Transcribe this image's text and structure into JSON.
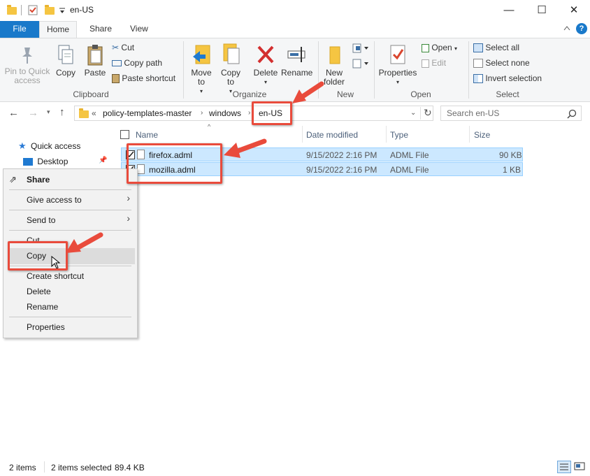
{
  "window": {
    "title": "en-US",
    "minimize": "—",
    "maximize": "☐",
    "close": "✕"
  },
  "tabs": {
    "file": "File",
    "home": "Home",
    "share": "Share",
    "view": "View"
  },
  "ribbon": {
    "pin": "Pin to Quick access",
    "copy": "Copy",
    "paste": "Paste",
    "cut": "Cut",
    "copy_path": "Copy path",
    "paste_shortcut": "Paste shortcut",
    "clipboard_group": "Clipboard",
    "move_to": "Move to",
    "copy_to": "Copy to",
    "delete": "Delete",
    "rename": "Rename",
    "organize_group": "Organize",
    "new_folder": "New folder",
    "new_group": "New",
    "properties": "Properties",
    "open": "Open",
    "edit": "Edit",
    "open_group": "Open",
    "select_all": "Select all",
    "select_none": "Select none",
    "invert_selection": "Invert selection",
    "select_group": "Select"
  },
  "address": {
    "overflow": "«",
    "crumbs": [
      "policy-templates-master",
      "windows",
      "en-US"
    ],
    "search_placeholder": "Search en-US"
  },
  "nav": {
    "quick_access": "Quick access",
    "desktop": "Desktop"
  },
  "columns": {
    "name": "Name",
    "date": "Date modified",
    "type": "Type",
    "size": "Size"
  },
  "files": [
    {
      "name": "firefox.adml",
      "date": "9/15/2022 2:16 PM",
      "type": "ADML File",
      "size": "90 KB"
    },
    {
      "name": "mozilla.adml",
      "date": "9/15/2022 2:16 PM",
      "type": "ADML File",
      "size": "1 KB"
    }
  ],
  "context_menu": {
    "share": "Share",
    "give_access": "Give access to",
    "send_to": "Send to",
    "cut": "Cut",
    "copy": "Copy",
    "create_shortcut": "Create shortcut",
    "delete": "Delete",
    "rename": "Rename",
    "properties": "Properties"
  },
  "status": {
    "item_count": "2 items",
    "selected": "2 items selected",
    "size": "89.4 KB"
  },
  "colors": {
    "accent": "#1979ca",
    "selection": "#cce8ff",
    "annotation": "#e94b3c"
  }
}
